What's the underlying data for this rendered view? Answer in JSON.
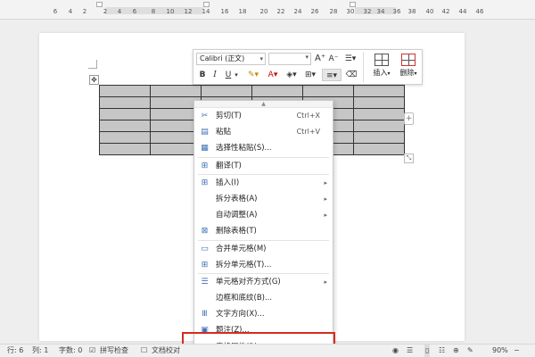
{
  "ruler": {
    "ticks": [
      "6",
      "4",
      "2",
      "2",
      "4",
      "6",
      "8",
      "10",
      "12",
      "14",
      "16",
      "18",
      "20",
      "22",
      "24",
      "26",
      "28",
      "30",
      "32",
      "34",
      "36",
      "38",
      "40",
      "42",
      "44",
      "46"
    ]
  },
  "mini_toolbar": {
    "font": "Calibri (正文)",
    "bold": "B",
    "italic": "I",
    "underline": "U",
    "insert_label": "插入",
    "delete_label": "删除"
  },
  "context_menu": {
    "items": [
      {
        "icon": "scissors-icon",
        "glyph": "✂",
        "label": "剪切(T)",
        "shortcut": "Ctrl+X"
      },
      {
        "icon": "paste-icon",
        "glyph": "▤",
        "label": "粘贴",
        "shortcut": "Ctrl+V"
      },
      {
        "icon": "paste-special-icon",
        "glyph": "▦",
        "label": "选择性粘贴(S)..."
      },
      {
        "icon": "translate-icon",
        "glyph": "⊞",
        "label": "翻译(T)",
        "sep_before": true
      },
      {
        "icon": "insert-table-icon",
        "glyph": "⊞",
        "label": "插入(I)",
        "submenu": true,
        "sep_before": true
      },
      {
        "label": "拆分表格(A)",
        "submenu": true
      },
      {
        "label": "自动调整(A)",
        "submenu": true
      },
      {
        "icon": "delete-table-icon",
        "glyph": "⊠",
        "label": "删除表格(T)"
      },
      {
        "icon": "merge-cells-icon",
        "glyph": "▭",
        "label": "合并单元格(M)",
        "sep_before": true
      },
      {
        "icon": "split-cells-icon",
        "glyph": "⊞",
        "label": "拆分单元格(T)..."
      },
      {
        "icon": "cell-align-icon",
        "glyph": "☰",
        "label": "单元格对齐方式(G)",
        "submenu": true,
        "sep_before": true
      },
      {
        "label": "边框和底纹(B)..."
      },
      {
        "icon": "text-direction-icon",
        "glyph": "Ⅲ",
        "label": "文字方向(X)..."
      },
      {
        "icon": "caption-icon",
        "glyph": "▣",
        "label": "题注(Z)..."
      },
      {
        "label": "表格属性(R)..."
      }
    ]
  },
  "status_bar": {
    "row": "行: 6",
    "col": "列: 1",
    "word_count": "字数: 0",
    "spell_check": "拼写检查",
    "doc_proof": "文档校对",
    "zoom": "90%"
  },
  "colors": {
    "highlight": "#d62b1f",
    "table_fill": "#c6c6c6",
    "icon_blue": "#3c6fb5"
  }
}
